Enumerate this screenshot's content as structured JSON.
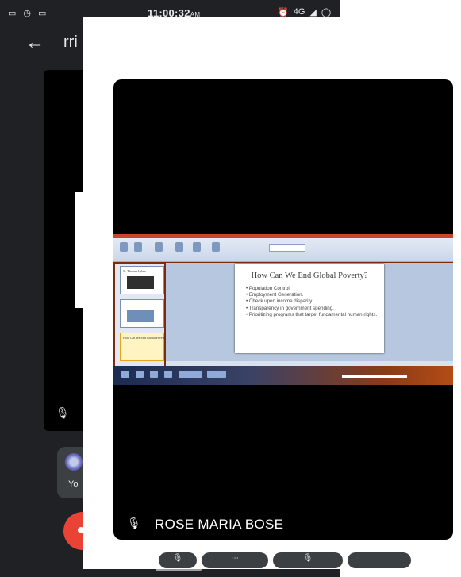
{
  "status_bar": {
    "left_icons": [
      "notification-icon",
      "whatsapp-icon",
      "cast-icon"
    ],
    "time": "11:00:32",
    "time_suffix": "AM",
    "right_icons": [
      "alarm-icon",
      "network-4g-icon",
      "signal-icon",
      "battery-icon"
    ],
    "network_label": "4G"
  },
  "header": {
    "back_icon": "back-arrow-icon",
    "title_partial": "rri"
  },
  "background_call": {
    "self_chip_label": "Yo",
    "mic_icon": "mic-off-icon",
    "end_call_icon": "end-call-icon"
  },
  "participant": {
    "name": "ROSE MARIA BOSE",
    "mic_icon": "mic-off-icon"
  },
  "shared_slide": {
    "title": "How Can We End Global Poverty?",
    "bullets": [
      "Population Control",
      "Employment Generation.",
      "Check upon income disparity.",
      "Transparency in government spending.",
      "Prioritizing programs that target fundamental human rights."
    ],
    "thumb_title": "Sr. Thomas Lybra"
  },
  "colors": {
    "meet_background": "#202124",
    "video_tile": "#000000",
    "end_call_red": "#ea4335",
    "ppt_titlebar": "#c8452a"
  }
}
